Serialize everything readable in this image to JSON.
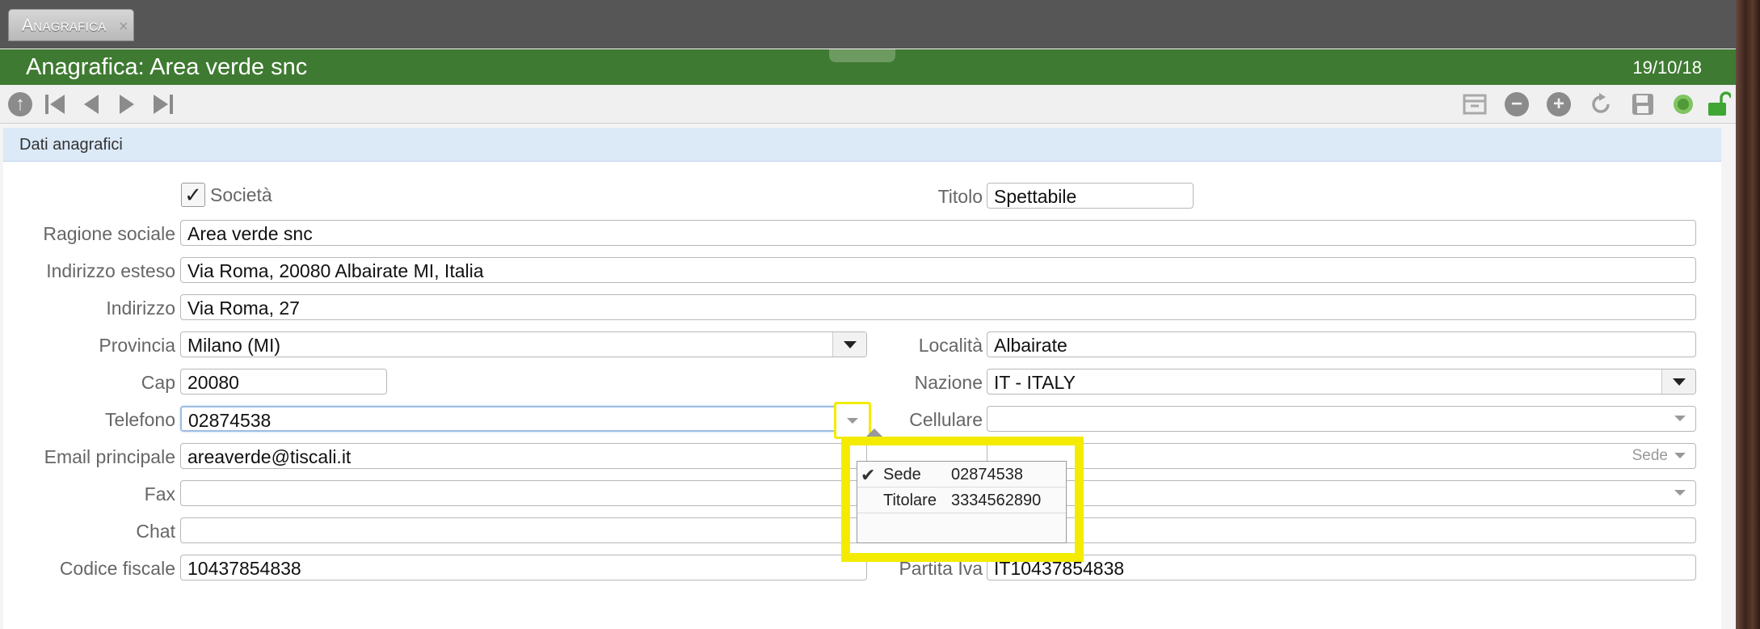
{
  "tab": {
    "label": "Anagrafica",
    "close": "×"
  },
  "header": {
    "title": "Anagrafica: Area verde snc",
    "date": "19/10/18"
  },
  "section": {
    "label": "Dati anagrafici"
  },
  "colors": {
    "header_green": "#3f7a32",
    "highlight_yellow": "#f3ec00",
    "section_blue": "#dce9f7"
  },
  "toolbar": {
    "left": [
      "up-circle-icon",
      "first-record-icon",
      "previous-record-icon",
      "next-record-icon",
      "last-record-icon"
    ],
    "right": [
      "archive-icon",
      "minus-circle-icon",
      "plus-circle-icon",
      "refresh-icon",
      "save-icon",
      "status-dot-icon",
      "unlock-icon"
    ]
  },
  "form": {
    "societa": {
      "label": "Società",
      "checked": true
    },
    "titolo": {
      "label": "Titolo",
      "value": "Spettabile"
    },
    "ragione_sociale": {
      "label": "Ragione sociale",
      "value": "Area verde snc"
    },
    "indirizzo_esteso": {
      "label": "Indirizzo esteso",
      "value": "Via Roma, 20080 Albairate MI, Italia"
    },
    "indirizzo": {
      "label": "Indirizzo",
      "value": "Via Roma, 27"
    },
    "provincia": {
      "label": "Provincia",
      "value": "Milano (MI)"
    },
    "localita": {
      "label": "Località",
      "value": "Albairate"
    },
    "cap": {
      "label": "Cap",
      "value": "20080"
    },
    "nazione": {
      "label": "Nazione",
      "value": "IT - ITALY"
    },
    "telefono": {
      "label": "Telefono",
      "value": "02874538"
    },
    "cellulare": {
      "label": "Cellulare",
      "value": ""
    },
    "email": {
      "label": "Email principale",
      "value": "areaverde@tiscali.it",
      "type_label": "Sede"
    },
    "fax": {
      "label": "Fax",
      "value": ""
    },
    "chat": {
      "label": "Chat",
      "value": ""
    },
    "codice_fiscale": {
      "label": "Codice fiscale",
      "value": "10437854838"
    },
    "partita_iva": {
      "label": "Partita Iva",
      "value": "IT10437854838"
    }
  },
  "phone_popup": {
    "items": [
      {
        "name": "Sede",
        "number": "02874538",
        "selected": true
      },
      {
        "name": "Titolare",
        "number": "3334562890",
        "selected": false
      }
    ]
  }
}
